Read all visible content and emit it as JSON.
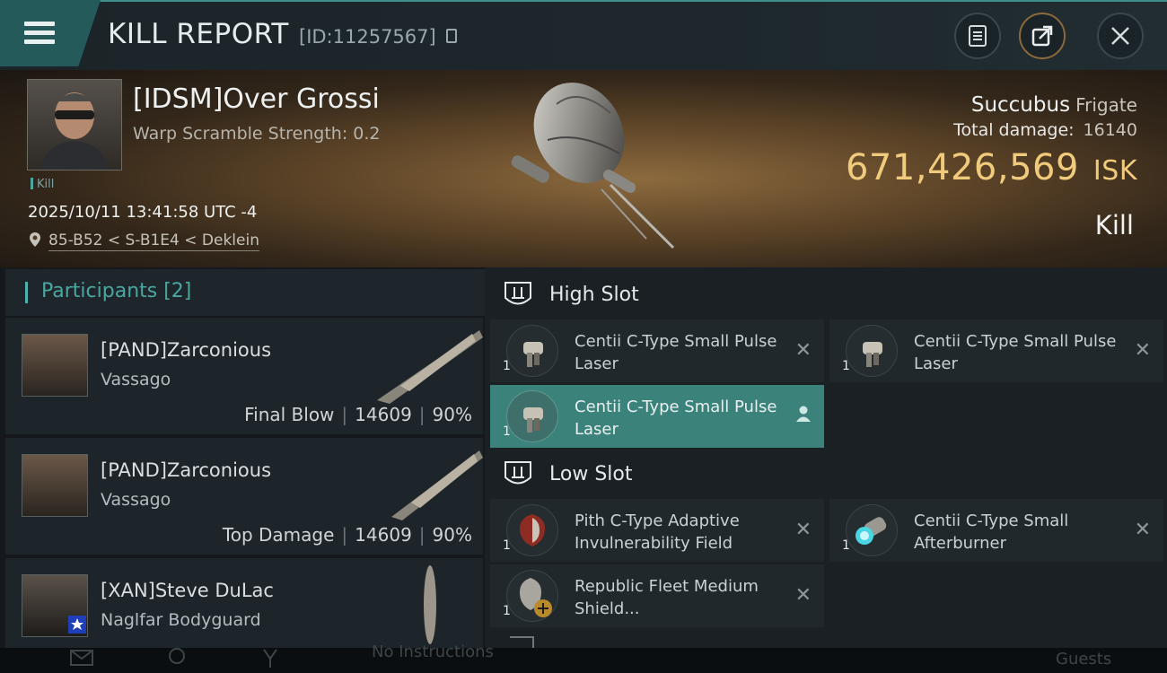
{
  "header": {
    "title": "KILL REPORT",
    "report_id": "[ID:11257567]"
  },
  "victim": {
    "name": "[IDSM]Over Grossi",
    "warp_scramble": "Warp Scramble Strength: 0.2",
    "tag": "Kill",
    "datetime": "2025/10/11 13:41:58 UTC -4",
    "location": "85-B52 < S-B1E4 < Deklein",
    "ship": "Succubus",
    "ship_class": "Frigate",
    "total_damage_label": "Total damage:",
    "total_damage": "16140",
    "isk_value": "671,426,569",
    "isk_unit": "ISK",
    "result": "Kill"
  },
  "participants": {
    "title": "Participants [2]",
    "rows": [
      {
        "name": "[PAND]Zarconious",
        "ship": "Vassago",
        "role": "Final Blow",
        "damage": "14609",
        "percent": "90%"
      },
      {
        "name": "[PAND]Zarconious",
        "ship": "Vassago",
        "role": "Top Damage",
        "damage": "14609",
        "percent": "90%"
      },
      {
        "name": "[XAN]Steve DuLac",
        "ship": "Naglfar Bodyguard"
      }
    ]
  },
  "slots": {
    "high": {
      "label": "High Slot",
      "items": [
        {
          "name": "Centii C-Type Small Pulse Laser",
          "qty": "1"
        },
        {
          "name": "Centii C-Type Small Pulse Laser",
          "qty": "1"
        },
        {
          "name": "Centii C-Type Small Pulse Laser",
          "qty": "1"
        }
      ]
    },
    "low": {
      "label": "Low Slot",
      "items": [
        {
          "name": "Pith C-Type Adaptive Invulnerability Field",
          "qty": "1"
        },
        {
          "name": "Centii C-Type Small Afterburner",
          "qty": "1"
        },
        {
          "name": "Republic Fleet Medium Shield...",
          "qty": "1"
        }
      ]
    }
  },
  "bottom": {
    "ghost_text": "No Instructions",
    "guests": "Guests"
  },
  "colors": {
    "accent": "#4aa7a0",
    "isk": "#f1cb7c",
    "selected_row": "#3b827b"
  }
}
